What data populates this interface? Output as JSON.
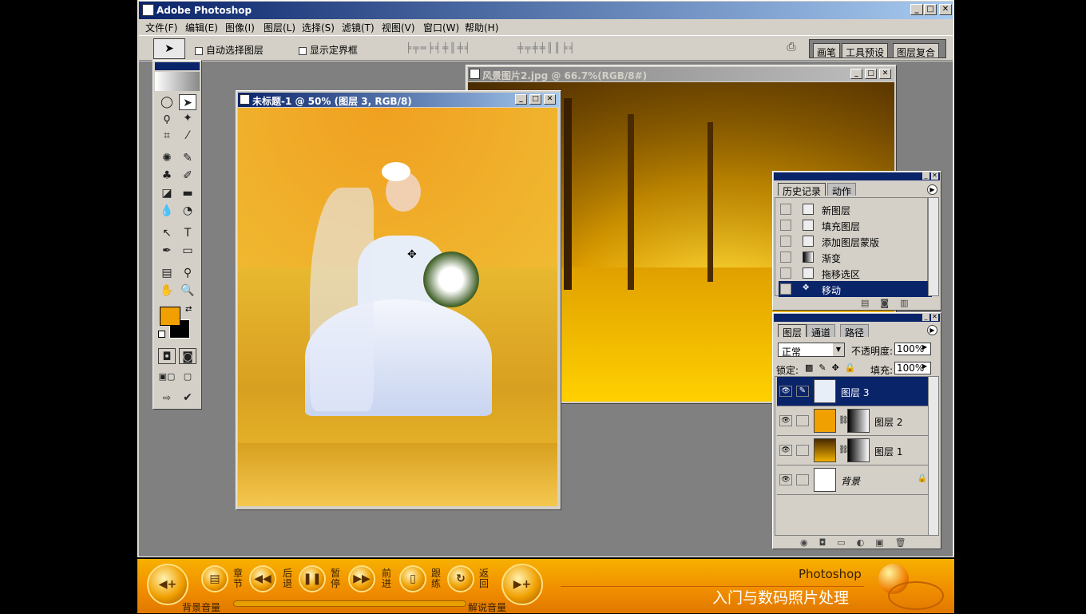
{
  "app": {
    "title": "Adobe Photoshop",
    "window_controls": [
      "_",
      "□",
      "✕"
    ]
  },
  "menu": [
    "文件(F)",
    "编辑(E)",
    "图像(I)",
    "图层(L)",
    "选择(S)",
    "滤镜(T)",
    "视图(V)",
    "窗口(W)",
    "帮助(H)"
  ],
  "options": {
    "auto_select": "自动选择图层",
    "show_bounds": "显示定界框",
    "palette_tabs": [
      "画笔",
      "工具预设",
      "图层复合"
    ]
  },
  "doc1": {
    "title": "未标题-1 @ 50% (图层 3, RGB/8)"
  },
  "doc2": {
    "title": "风景图片2.jpg @ 66.7%(RGB/8#)"
  },
  "history": {
    "tabs": [
      "历史记录",
      "动作"
    ],
    "items": [
      {
        "label": "新图层",
        "selected": false
      },
      {
        "label": "填充图层",
        "selected": false
      },
      {
        "label": "添加图层蒙版",
        "selected": false
      },
      {
        "label": "渐变",
        "selected": false
      },
      {
        "label": "拖移选区",
        "selected": false
      },
      {
        "label": "移动",
        "selected": true
      }
    ]
  },
  "layers": {
    "tabs": [
      "图层",
      "通道",
      "路径"
    ],
    "blend_mode": "正常",
    "opacity_label": "不透明度:",
    "opacity_value": "100%",
    "lock_label": "锁定:",
    "fill_label": "填充:",
    "fill_value": "100%",
    "items": [
      {
        "name": "图层 3",
        "selected": true,
        "has_mask": false
      },
      {
        "name": "图层 2",
        "selected": false,
        "has_mask": true
      },
      {
        "name": "图层 1",
        "selected": false,
        "has_mask": true
      },
      {
        "name": "背景",
        "selected": false,
        "has_mask": false,
        "locked": true
      }
    ]
  },
  "player": {
    "bg_volume": "背景音量",
    "narration_volume": "解说音量",
    "buttons": [
      {
        "label": "章节",
        "icon": "book-icon"
      },
      {
        "label": "后退",
        "icon": "rewind-icon"
      },
      {
        "label": "暂停",
        "icon": "pause-icon"
      },
      {
        "label": "前进",
        "icon": "forward-icon"
      },
      {
        "label": "跟练",
        "icon": "mouse-icon"
      },
      {
        "label": "返回",
        "icon": "return-icon"
      }
    ],
    "brand_line1": "Photoshop",
    "brand_line2": "入门与数码照片处理"
  },
  "colors": {
    "foreground": "#f0a000",
    "background": "#000000",
    "selection": "#0a246a"
  }
}
